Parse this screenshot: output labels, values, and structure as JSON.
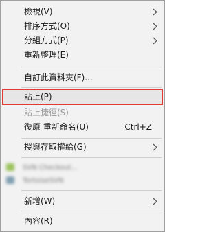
{
  "menu": {
    "view": {
      "label": "檢視(V)"
    },
    "sort_by": {
      "label": "排序方式(O)"
    },
    "group_by": {
      "label": "分組方式(P)"
    },
    "refresh": {
      "label": "重新整理(E)"
    },
    "customize_folder": {
      "label": "自訂此資料夾(F)..."
    },
    "paste": {
      "label": "貼上(P)"
    },
    "paste_shortcut": {
      "label": "貼上捷徑(S)"
    },
    "undo_rename": {
      "label": "復原 重新命名(U)",
      "shortcut": "Ctrl+Z"
    },
    "give_access": {
      "label": "授與存取權給(G)"
    },
    "blurred_items": [
      {
        "text": "SVN Checkout..."
      },
      {
        "text": "TortoiseSVN"
      }
    ],
    "new": {
      "label": "新增(W)"
    },
    "properties": {
      "label": "內容(R)"
    }
  },
  "colors": {
    "menu_background": "#f2f2f2",
    "highlight_background": "#e6e6e6",
    "highlight_outline": "#e53935",
    "separator": "#cfcfcf",
    "disabled_text": "#9a9a9a"
  },
  "icons": {
    "submenu_arrow": "chevron-right-icon",
    "blurred_item_1": "svn-checkout-icon",
    "blurred_item_2": "tortoisesvn-icon"
  }
}
